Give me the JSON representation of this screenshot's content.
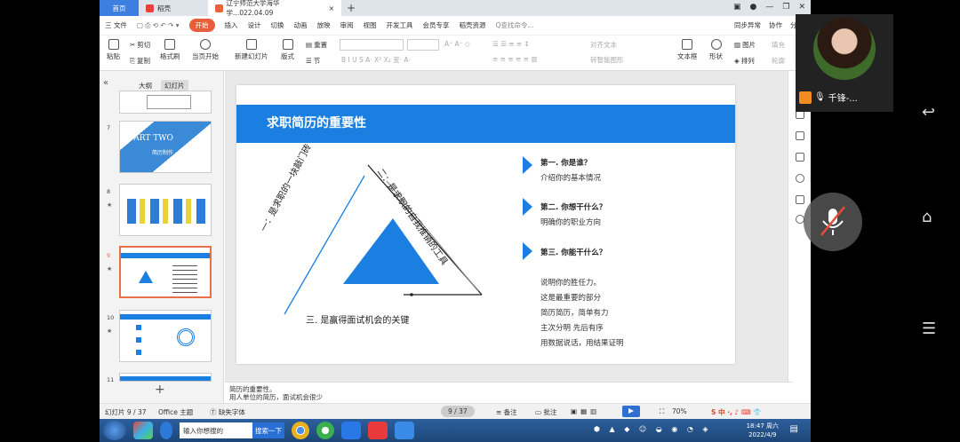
{
  "tabs": {
    "home": "首页",
    "docer": "稻壳",
    "doc": "辽宁师范大学海华学...022.04.09",
    "new_tab": "+"
  },
  "menu": {
    "file": "三 文件",
    "items": [
      "开始",
      "插入",
      "设计",
      "切换",
      "动画",
      "放映",
      "审阅",
      "视图",
      "开发工具",
      "会员专享",
      "稻壳资源"
    ],
    "search": "Q查找命令...",
    "sync": "同步异常",
    "collab": "协作",
    "share": "分享"
  },
  "ribbon": {
    "paste": "粘贴",
    "cut": "剪切",
    "copy": "复制",
    "format_painter": "格式刷",
    "from_current": "当页开始",
    "new_slide": "新建幻灯片",
    "layout": "版式",
    "section": "节",
    "reset": "重置",
    "textbox": "文本框",
    "shape": "形状",
    "arrange": "排列",
    "picture": "图片",
    "fill": "填充",
    "outline": "轮廓",
    "align_text": "对齐文本",
    "smartart": "转智能图形"
  },
  "panel": {
    "outline_tab": "大纲",
    "slides_tab": "幻灯片",
    "thumbs": [
      {
        "num": "",
        "text": ""
      },
      {
        "num": "7",
        "text": "PART TWO",
        "sub": "简历制作"
      },
      {
        "num": "8",
        "text": ""
      },
      {
        "num": "9",
        "text": ""
      },
      {
        "num": "10",
        "text": ""
      },
      {
        "num": "11",
        "text": ""
      }
    ],
    "add": "+"
  },
  "slide": {
    "title": "求职简历的重要性",
    "tri_label_left": "一：是求职的一块敲门砖",
    "tri_label_right": "二：是求职的自我推销的工具",
    "tri_label_bottom": "三. 是赢得面试机会的关键",
    "items": [
      {
        "title": "第一. 你是谁？",
        "desc": "介绍你的基本情况"
      },
      {
        "title": "第二. 你想干什么？",
        "desc": "明确你的职业方向"
      },
      {
        "title": "第三. 你能干什么？",
        "desc": ""
      }
    ],
    "extra_lines": [
      "说明你的胜任力。",
      "这是最重要的部分",
      "简历简历，简单有力",
      "主次分明   先后有序",
      "用数据说话，用结果证明"
    ]
  },
  "notes": {
    "line1": "简历的重要性。",
    "line2": "用人单位的简历，面试机会很少"
  },
  "status": {
    "slide_count": "幻灯片 9 / 37",
    "theme": "Office 主题",
    "missing_font": "缺失字体",
    "page_indicator": "9 / 37",
    "notes": "备注",
    "comments": "批注",
    "zoom": "70%"
  },
  "taskbar": {
    "search_placeholder": "输入你想搜的",
    "search_button": "搜索一下",
    "time": "18:47 周六",
    "date": "2022/4/9"
  },
  "camera": {
    "name": "千锋-..."
  }
}
